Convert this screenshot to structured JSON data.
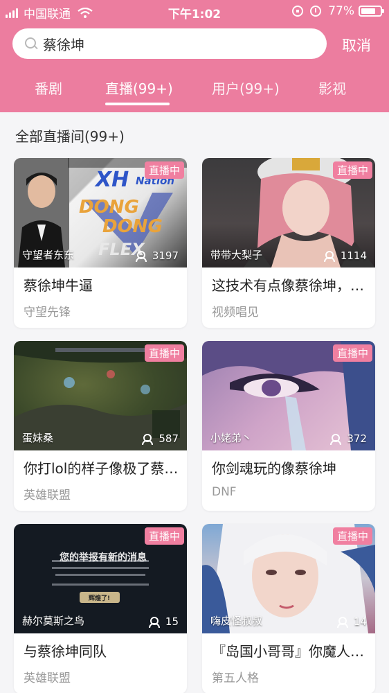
{
  "status_bar": {
    "carrier": "中国联通",
    "time": "下午1:02",
    "battery": "77%",
    "battery_level": 0.77
  },
  "search": {
    "query": "蔡徐坤",
    "cancel_label": "取消"
  },
  "tabs": [
    {
      "label": "番剧",
      "active": false
    },
    {
      "label": "直播(99+)",
      "active": true
    },
    {
      "label": "用户(99+)",
      "active": false
    },
    {
      "label": "影视",
      "active": false
    }
  ],
  "section_title": "全部直播间(99+)",
  "live_badge": "直播中",
  "cards": [
    {
      "streamer": "守望者东东",
      "viewers": "3197",
      "title": "蔡徐坤牛逼",
      "category": "守望先锋",
      "thumb_art": {
        "line1": "XH",
        "line2": "Nation",
        "line3": "DONG",
        "line4": "DONG",
        "line5": "FLEX"
      }
    },
    {
      "streamer": "带带大梨子",
      "viewers": "1114",
      "title": "这技术有点像蔡徐坤，…",
      "category": "视频唱见"
    },
    {
      "streamer": "蛋妹桑",
      "viewers": "587",
      "title": "你打lol的样子像极了蔡…",
      "category": "英雄联盟"
    },
    {
      "streamer": "小姥弟丶",
      "viewers": "372",
      "title": "你剑魂玩的像蔡徐坤",
      "category": "DNF"
    },
    {
      "streamer": "赫尔莫斯之鸟",
      "viewers": "15",
      "title": "与蔡徐坤同队",
      "category": "英雄联盟",
      "thumb_art": {
        "dialog_title": "您的举报有新的消息",
        "dialog_button": "辉煌了!"
      }
    },
    {
      "streamer": "嗨皮怪叔叔",
      "viewers": "14",
      "title": "『岛国小哥哥』你魔人…",
      "category": "第五人格"
    }
  ]
}
